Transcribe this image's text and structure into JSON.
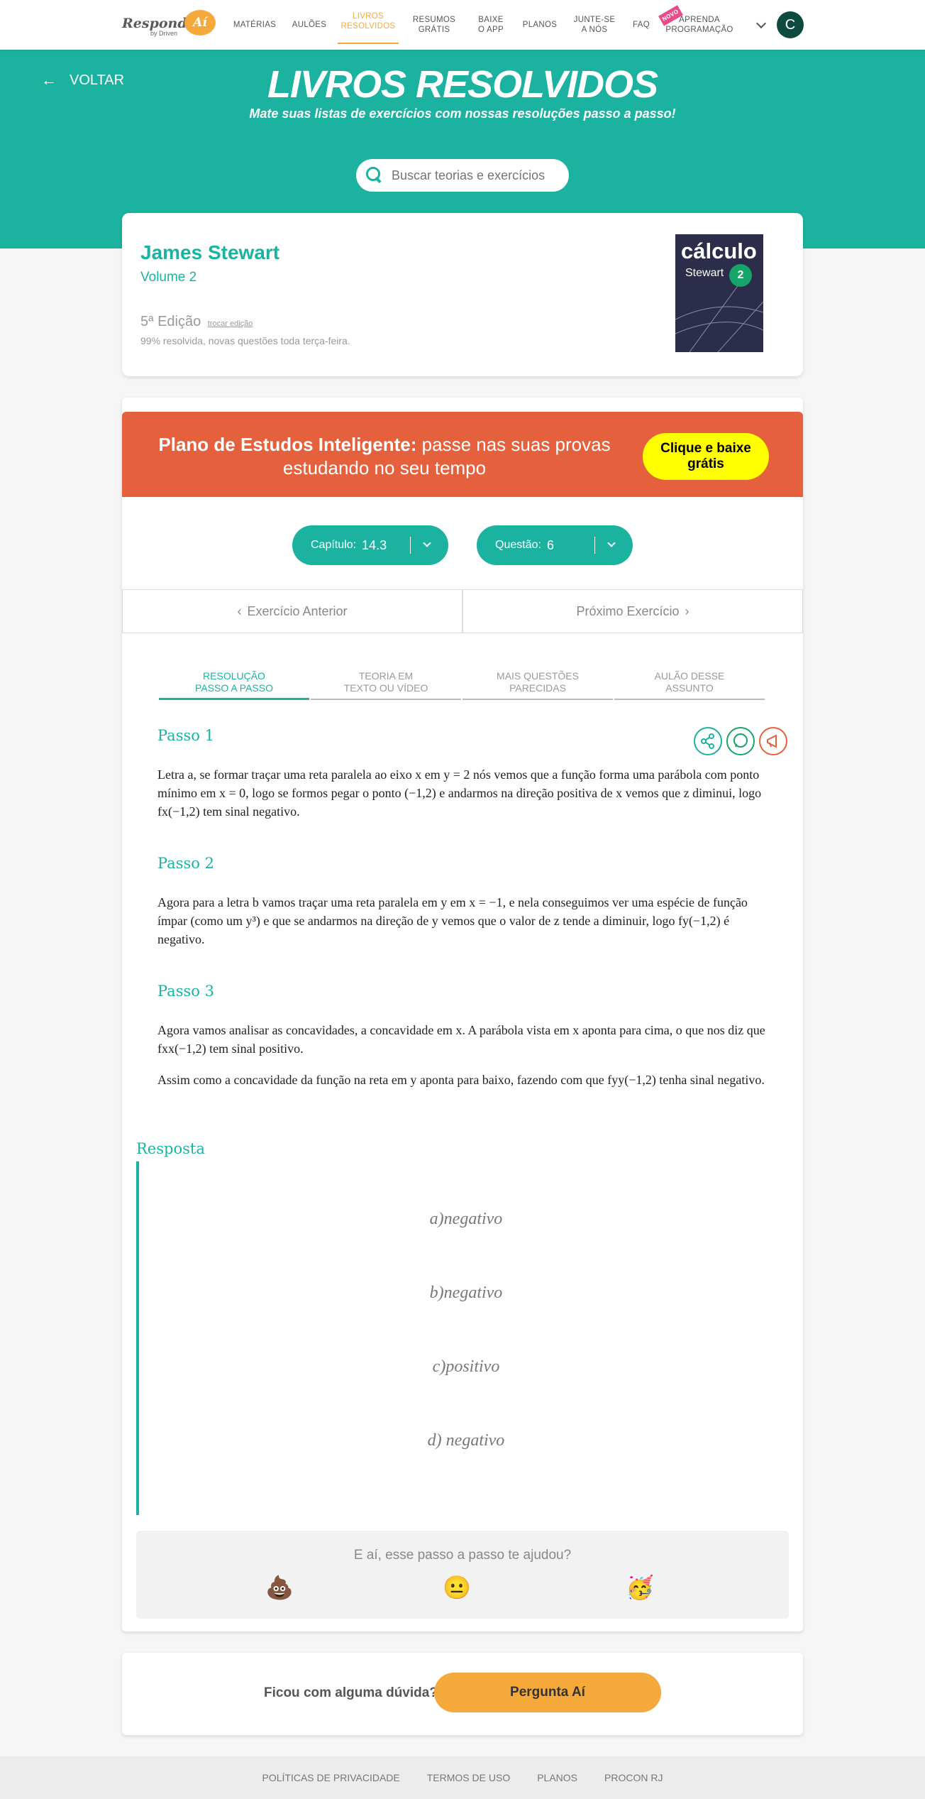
{
  "header": {
    "logo_text": "Responde",
    "logo_blob": "Aí",
    "logo_sub": "by Driven",
    "nav": [
      {
        "label": "MATÉRIAS"
      },
      {
        "label": "AULÕES"
      },
      {
        "label": "LIVROS\nRESOLVIDOS",
        "active": true
      },
      {
        "label": "RESUMOS\nGRÁTIS"
      },
      {
        "label": "BAIXE\nO APP"
      },
      {
        "label": "PLANOS"
      },
      {
        "label": "JUNTE-SE\nA NÓS"
      },
      {
        "label": "FAQ"
      },
      {
        "label": "APRENDA\nPROGRAMAÇÃO",
        "badge": "NOVO"
      }
    ],
    "avatar_letter": "C"
  },
  "banner": {
    "back_label": "VOLTAR",
    "title": "LIVROS RESOLVIDOS",
    "subtitle": "Mate suas listas de exercícios com nossas resoluções passo a passo!",
    "search_placeholder": "Buscar teorias e exercícios"
  },
  "book": {
    "author": "James Stewart",
    "volume": "Volume 2",
    "edition": "5ª Edição",
    "change_edition": "trocar edição",
    "resolved": "99% resolvida, novas questões toda terça-feira.",
    "cover_title": "cálculo",
    "cover_author": "Stewart",
    "cover_number": "2"
  },
  "promo": {
    "bold": "Plano de Estudos Inteligente:",
    "text": " passe nas suas provas estudando no seu tempo",
    "button": "Clique e baixe grátis"
  },
  "selectors": {
    "chapter_label": "Capítulo:",
    "chapter_value": "14.3",
    "question_label": "Questão:",
    "question_value": "6"
  },
  "exercise_nav": {
    "prev": "Exercício Anterior",
    "next": "Próximo Exercício"
  },
  "tabs": [
    {
      "label": "RESOLUÇÃO\nPASSO A PASSO"
    },
    {
      "label": "TEORIA EM\nTEXTO OU VÍDEO"
    },
    {
      "label": "MAIS QUESTÕES\nPARECIDAS"
    },
    {
      "label": "AULÃO DESSE\nASSUNTO"
    }
  ],
  "steps": {
    "s1_title": "Passo 1",
    "s1_text": "Letra a, se formar traçar uma reta paralela ao eixo x em y = 2 nós vemos que a função forma uma parábola com ponto mínimo em x = 0, logo se formos pegar o ponto (−1,2) e andarmos na direção positiva de x vemos que z diminui, logo fx(−1,2) tem sinal negativo.",
    "s2_title": "Passo 2",
    "s2_text": "Agora para a letra b vamos traçar uma reta paralela em y em x = −1, e nela conseguimos ver uma espécie de função ímpar (como um y³) e que se andarmos na direção de y vemos que o valor de z tende a diminuir, logo fy(−1,2) é negativo.",
    "s3_title": "Passo 3",
    "s3_text1": "Agora vamos analisar as concavidades, a concavidade em x. A parábola vista em x aponta para cima, o que nos diz que fxx(−1,2) tem sinal positivo.",
    "s3_text2": "Assim como a concavidade da função na reta em y aponta para baixo, fazendo com que fyy(−1,2) tenha sinal negativo."
  },
  "answer": {
    "title": "Resposta",
    "items": [
      "a)negativo",
      "b)negativo",
      "c)positivo",
      "d) negativo"
    ]
  },
  "feedback": {
    "question": "E aí, esse passo a passo te ajudou?",
    "emojis": [
      "💩",
      "😐",
      "🥳"
    ]
  },
  "ask": {
    "text": "Ficou com alguma dúvida?",
    "button": "Pergunta Aí"
  },
  "footer": [
    "POLÍTICAS DE PRIVACIDADE",
    "TERMOS DE USO",
    "PLANOS",
    "PROCON RJ"
  ],
  "colors": {
    "teal": "#1bb3a0",
    "orange": "#f6a93b",
    "promo": "#e5603c",
    "yellow": "#ffff00"
  }
}
